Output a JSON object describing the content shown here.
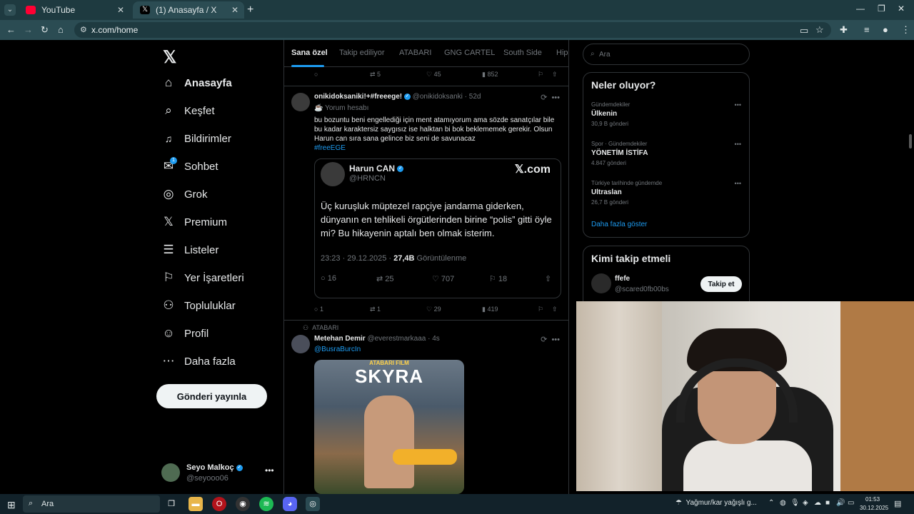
{
  "browser": {
    "tabs": [
      {
        "title": "YouTube",
        "active": false
      },
      {
        "title": "(1) Anasayfa / X",
        "active": true
      }
    ],
    "url": "x.com/home"
  },
  "sidebar": {
    "logo": "𝕏",
    "items": [
      {
        "label": "Anasayfa",
        "icon": "home-icon",
        "glyph": "⌂",
        "active": true
      },
      {
        "label": "Keşfet",
        "icon": "search-icon",
        "glyph": "⌕"
      },
      {
        "label": "Bildirimler",
        "icon": "bell-icon",
        "glyph": "🔔"
      },
      {
        "label": "Sohbet",
        "icon": "mail-icon",
        "glyph": "✉",
        "badge": "1"
      },
      {
        "label": "Grok",
        "icon": "grok-icon",
        "glyph": "◎"
      },
      {
        "label": "Premium",
        "icon": "x-premium-icon",
        "glyph": "𝕏"
      },
      {
        "label": "Listeler",
        "icon": "list-icon",
        "glyph": "☰"
      },
      {
        "label": "Yer İşaretleri",
        "icon": "bookmark-icon",
        "glyph": "⚐"
      },
      {
        "label": "Topluluklar",
        "icon": "communities-icon",
        "glyph": "⚇"
      },
      {
        "label": "Profil",
        "icon": "profile-icon",
        "glyph": "☺"
      },
      {
        "label": "Daha fazla",
        "icon": "more-circle-icon",
        "glyph": "⋯"
      }
    ],
    "post_button": "Gönderi yayınla",
    "profile": {
      "name": "Seyo Malkoç",
      "handle": "@seyooo06"
    }
  },
  "feed": {
    "tabs": [
      "Sana özel",
      "Takip ediliyor",
      "ATABARI",
      "GNG CARTEL",
      "South Side",
      "Hip"
    ],
    "first_actions": {
      "replies": "",
      "reposts": "5",
      "likes": "45",
      "views": "852"
    },
    "tweet1": {
      "name": "onikidoksaniki!+#freeege!",
      "handle": "@onikidoksanki",
      "time": "52d",
      "sub": "Yorum hesabı",
      "text": "bu bozuntu beni engellediği için ment atamıyorum ama sözde sanatçılar bile bu kadar karaktersiz saygısız ise halktan bi bok beklememek gerekir. Olsun Harun can sıra sana gelince biz seni de savunacaz",
      "hashtag": "#freeEGE",
      "quote": {
        "name": "Harun CAN",
        "handle": "@HRNCN",
        "logo": "𝕏.com",
        "text": "Üç kuruşluk müptezel rapçiye jandarma giderken, dünyanın en tehlikeli örgütlerinden birine “polis” gitti öyle mi? Bu hikayenin aptalı ben olmak isterim.",
        "datetime": "23:23 · 29.12.2025 · ",
        "views": "27,4B",
        "views_label": " Görüntülenme",
        "replies": "16",
        "reposts": "25",
        "likes": "707",
        "bookmarks": "18"
      },
      "actions": {
        "replies": "1",
        "reposts": "1",
        "likes": "29",
        "views": "419"
      }
    },
    "tweet2": {
      "context": "ATABARI",
      "name": "Metehan Demir",
      "handle": "@everestmarkaaa",
      "time": "4s",
      "mention": "@BusraBurcIn",
      "poster_top": "ATABARI FILM",
      "poster_title": "SKYRA"
    }
  },
  "right": {
    "search_placeholder": "Ara",
    "trends_title": "Neler oluyor?",
    "trends": [
      {
        "category": "Gündemdekiler",
        "name": "Ülkenin",
        "count": "30,9 B gönderi"
      },
      {
        "category": "Spor · Gündemdekiler",
        "name": "YÖNETİM İSTİFA",
        "count": "4.847 gönderi"
      },
      {
        "category": "Türkiye tarihinde gündemde",
        "name": "Ultraslan",
        "count": "26,7 B gönderi"
      }
    ],
    "show_more": "Daha fazla göster",
    "who_title": "Kimi takip etmeli",
    "who": {
      "name": "ffefe",
      "handle": "@scared0fb00bs",
      "button": "Takip et"
    }
  },
  "taskbar": {
    "search_placeholder": "Ara",
    "weather": "Yağmur/kar yağışlı g...",
    "time": "01:53",
    "date": "30.12.2025"
  },
  "colors": {
    "accent": "#1d9bf0",
    "bg": "#000000",
    "border": "#2f3336",
    "muted": "#71767b"
  }
}
